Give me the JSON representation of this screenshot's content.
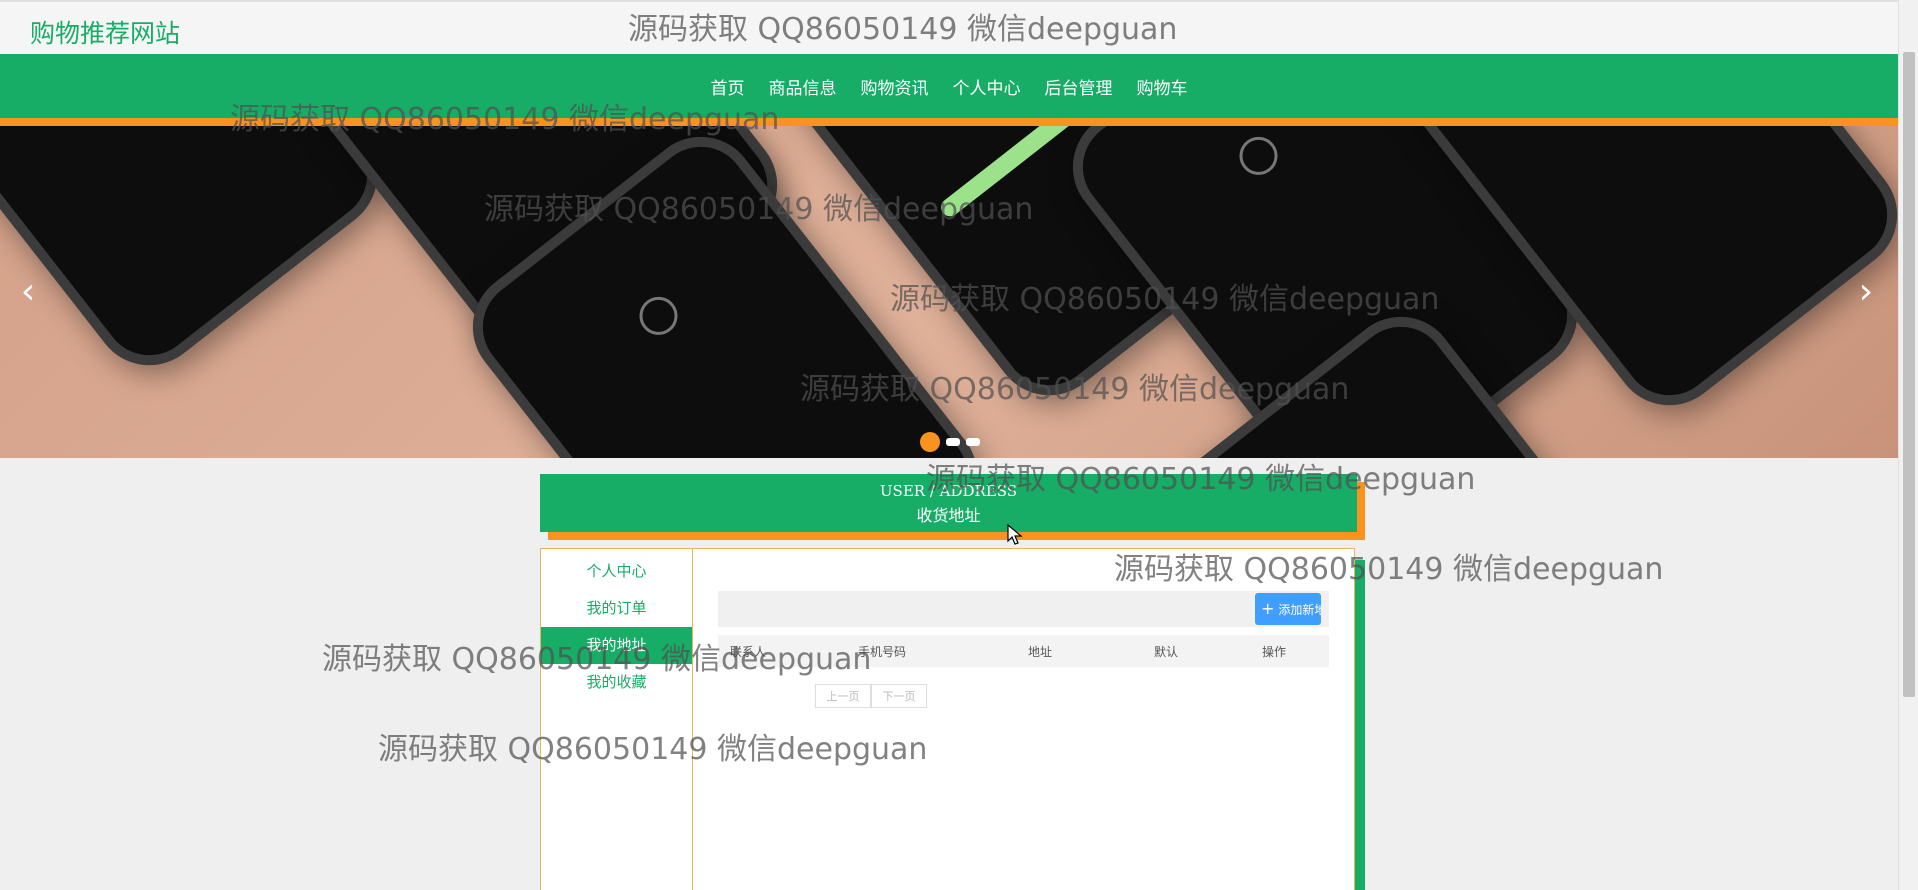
{
  "site": {
    "title": "购物推荐网站"
  },
  "nav": {
    "items": [
      "首页",
      "商品信息",
      "购物资讯",
      "个人中心",
      "后台管理",
      "购物车"
    ]
  },
  "banner": {
    "prev_icon": "‹",
    "next_icon": "›"
  },
  "section": {
    "title_en": "USER / ADDRESS",
    "title_cn": "收货地址"
  },
  "sidebar": {
    "items": [
      "个人中心",
      "我的订单",
      "我的地址",
      "我的收藏"
    ],
    "active": "我的地址"
  },
  "toolbar": {
    "add_label": "添加新地址",
    "add_icon": "+"
  },
  "table": {
    "headers": [
      "联系人",
      "手机号码",
      "地址",
      "默认",
      "操作"
    ]
  },
  "pager": {
    "prev": "上一页",
    "next": "下一页"
  },
  "watermark": "源码获取 QQ86050149 微信deepguan",
  "colors": {
    "primary": "#17ad67",
    "accent": "#f7931e",
    "button": "#409eff"
  }
}
